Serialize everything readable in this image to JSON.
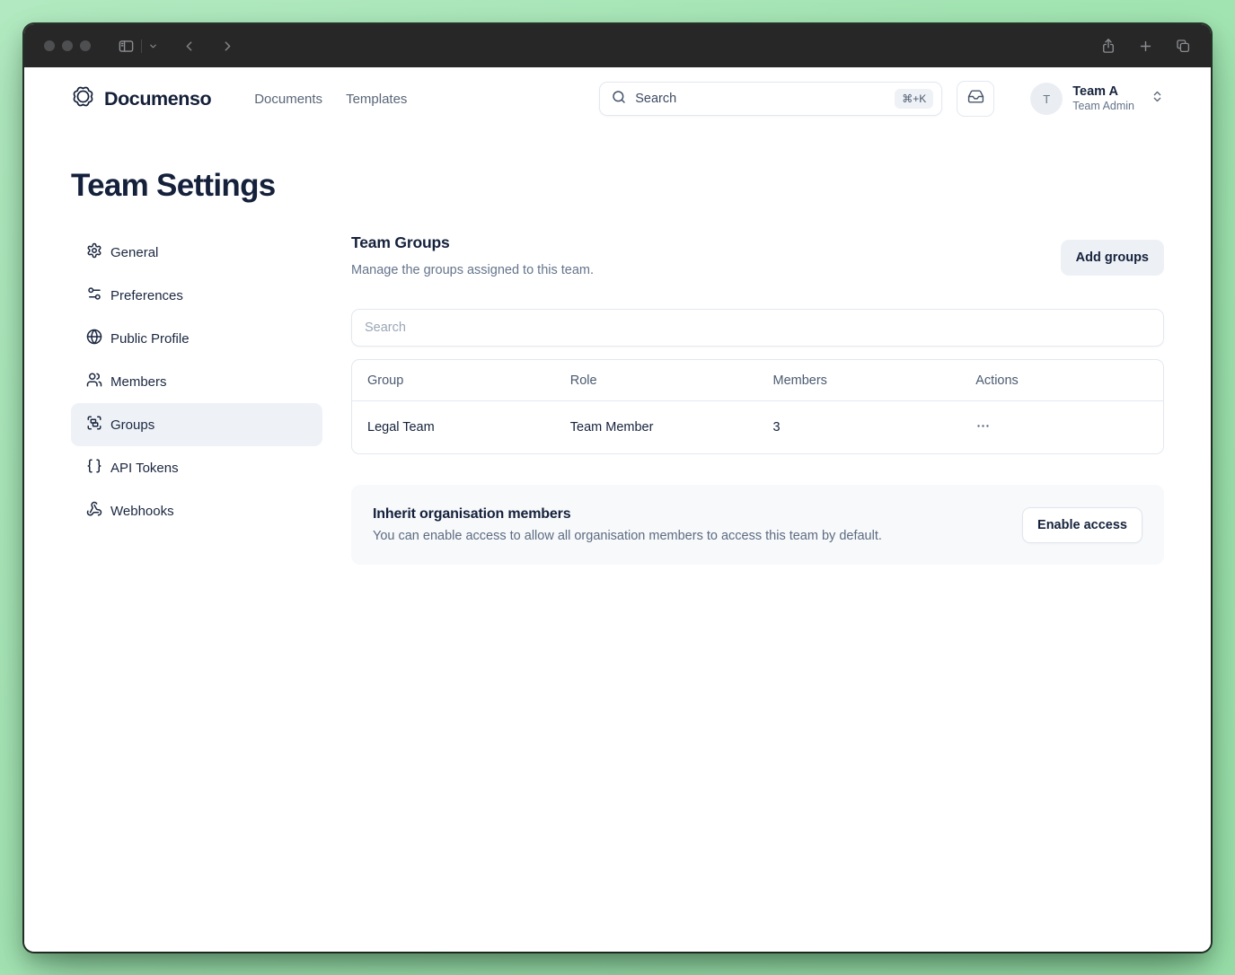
{
  "titlebar": {
    "icons": [
      "sidebar-toggle-icon",
      "chevron-down-icon",
      "back-icon",
      "forward-icon",
      "share-icon",
      "new-tab-icon",
      "tab-overview-icon"
    ]
  },
  "header": {
    "brand": "Documenso",
    "logo_icon": "documenso-rosette-icon",
    "nav": [
      {
        "label": "Documents"
      },
      {
        "label": "Templates"
      }
    ],
    "search": {
      "label": "Search",
      "shortcut": "⌘+K",
      "icon": "search-icon"
    },
    "inbox_icon": "inbox-icon",
    "account": {
      "initial": "T",
      "name": "Team A",
      "role": "Team Admin",
      "chevron_icon": "chevrons-up-down-icon"
    }
  },
  "page": {
    "title": "Team Settings"
  },
  "sidebar": {
    "items": [
      {
        "label": "General",
        "icon": "gear-icon",
        "active": false
      },
      {
        "label": "Preferences",
        "icon": "sliders-icon",
        "active": false
      },
      {
        "label": "Public Profile",
        "icon": "globe-icon",
        "active": false
      },
      {
        "label": "Members",
        "icon": "users-icon",
        "active": false
      },
      {
        "label": "Groups",
        "icon": "group-icon",
        "active": true
      },
      {
        "label": "API Tokens",
        "icon": "braces-icon",
        "active": false
      },
      {
        "label": "Webhooks",
        "icon": "webhook-icon",
        "active": false
      }
    ]
  },
  "main": {
    "section_title": "Team Groups",
    "section_subtitle": "Manage the groups assigned to this team.",
    "add_button_label": "Add groups",
    "search_placeholder": "Search",
    "table": {
      "columns": [
        "Group",
        "Role",
        "Members",
        "Actions"
      ],
      "rows": [
        {
          "group": "Legal Team",
          "role": "Team Member",
          "members": "3",
          "actions_icon": "ellipsis-icon"
        }
      ]
    },
    "inherit_card": {
      "title": "Inherit organisation members",
      "description": "You can enable access to allow all organisation members to access this team by default.",
      "button_label": "Enable access"
    }
  },
  "colors": {
    "desktop_green": "#a3e4b3",
    "titlebar_bg": "#272728",
    "text_dark": "#15213b",
    "text_muted": "#64748b",
    "border": "#e3e8ef",
    "selected_item_bg": "#eef2f7",
    "soft_button_bg": "#edf1f6",
    "card_bg": "#f7f9fb"
  }
}
